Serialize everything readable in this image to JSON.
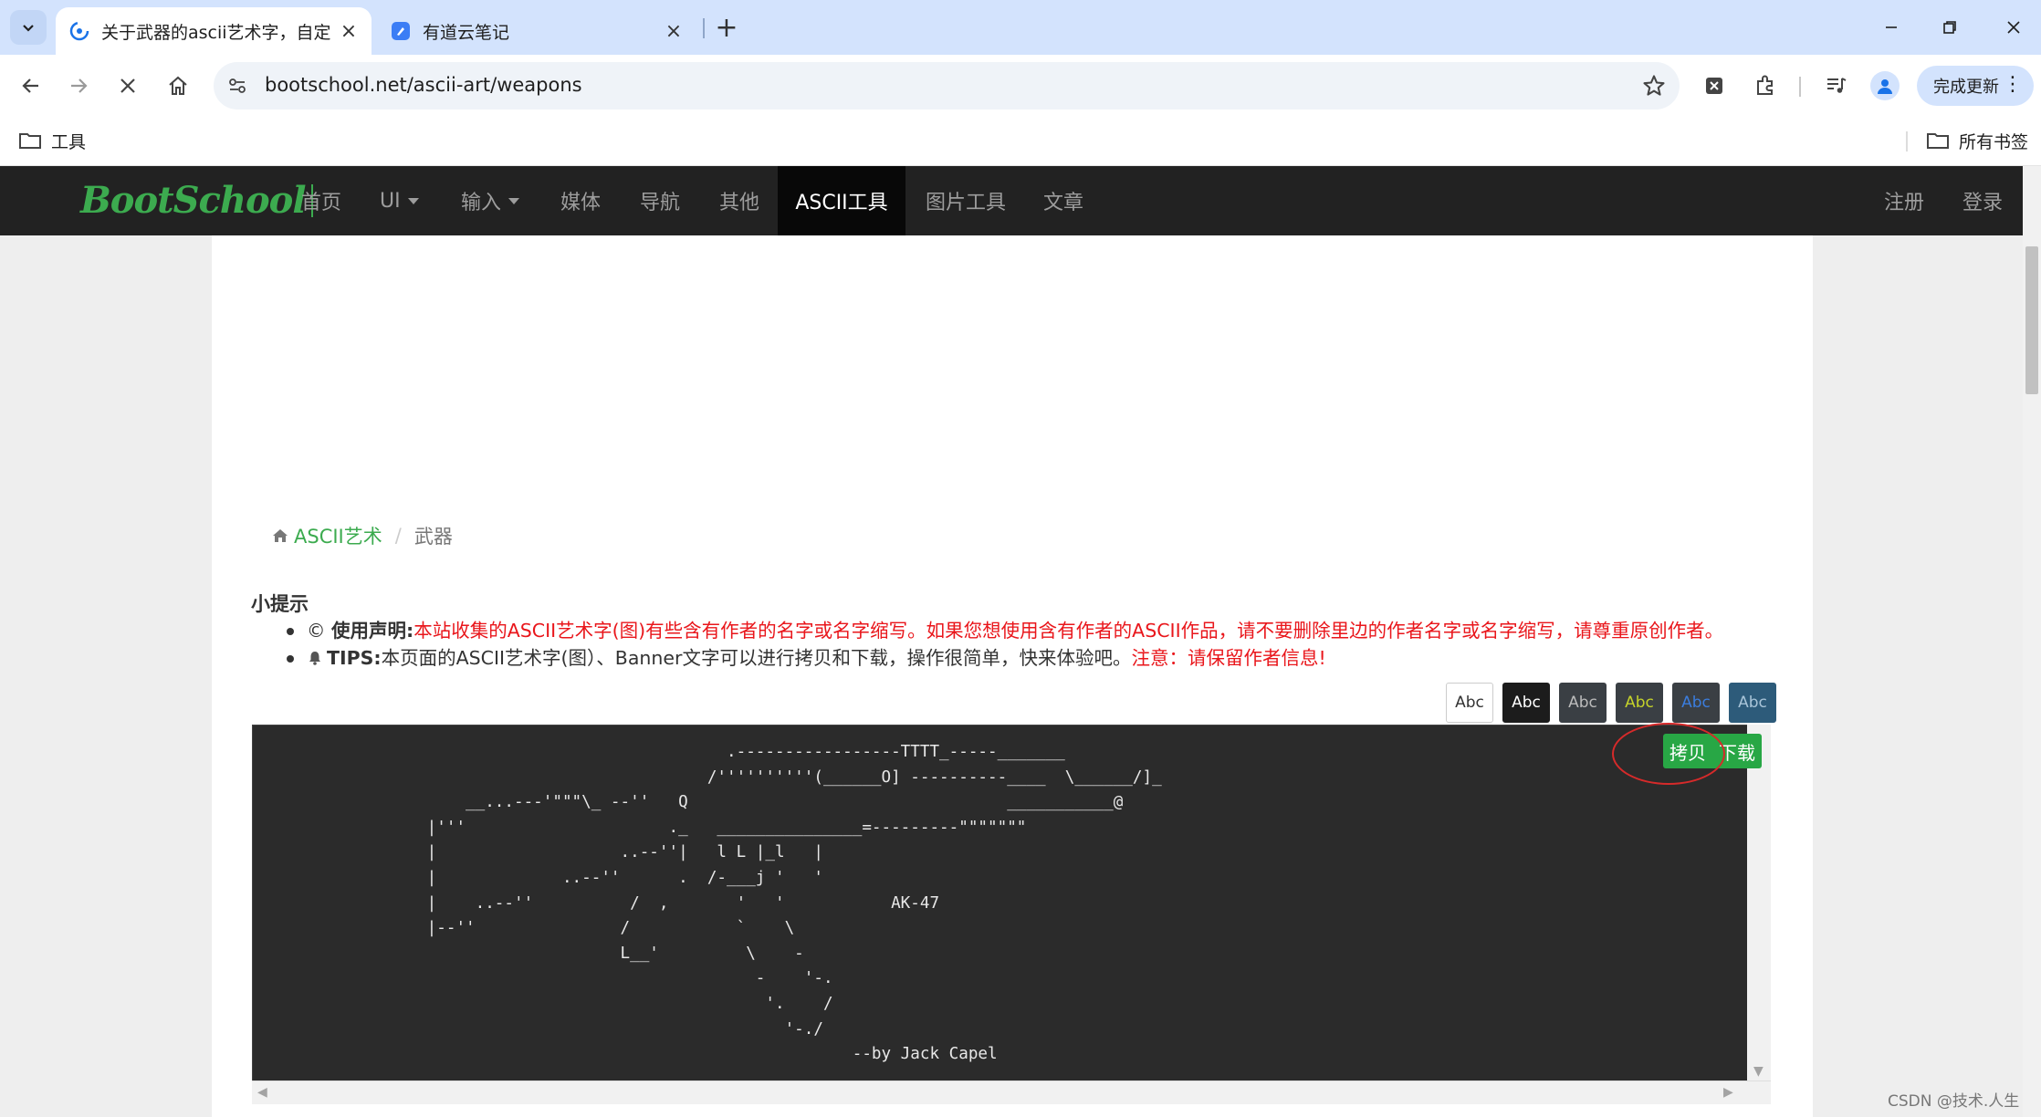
{
  "browser": {
    "tabs": [
      {
        "title": "关于武器的ascii艺术字，自定义",
        "active": true
      },
      {
        "title": "有道云笔记",
        "active": false
      }
    ],
    "url": "bootschool.net/ascii-art/weapons",
    "update_label": "完成更新",
    "bookmarks": {
      "tools": "工具",
      "all_bookmarks": "所有书签"
    }
  },
  "site": {
    "logo": "BootSchool",
    "nav": [
      {
        "label": "首页"
      },
      {
        "label": "UI",
        "dropdown": true
      },
      {
        "label": "输入",
        "dropdown": true
      },
      {
        "label": "媒体"
      },
      {
        "label": "导航"
      },
      {
        "label": "其他"
      },
      {
        "label": "ASCII工具",
        "active": true
      },
      {
        "label": "图片工具"
      },
      {
        "label": "文章"
      }
    ],
    "nav_right": {
      "register": "注册",
      "login": "登录"
    }
  },
  "breadcrumb": {
    "home": "ASCII艺术",
    "current": "武器"
  },
  "tips": {
    "title": "小提示",
    "item1_label": "使用声明:",
    "item1_text": "本站收集的ASCII艺术字(图)有些含有作者的名字或名字缩写。如果您想使用含有作者的ASCII作品，请不要删除里边的作者名字或名字缩写，请尊重原创作者。",
    "item2_label": "TIPS:",
    "item2_text": "本页面的ASCII艺术字(图）、Banner文字可以进行拷贝和下载，操作很简单，快来体验吧。",
    "item2_warn": "注意：请保留作者信息!"
  },
  "themes": [
    {
      "label": "Abc",
      "bg": "#ffffff",
      "fg": "#333333",
      "border": "#cccccc"
    },
    {
      "label": "Abc",
      "bg": "#1c1c1c",
      "fg": "#ffffff",
      "border": "#1c1c1c"
    },
    {
      "label": "Abc",
      "bg": "#3a3f44",
      "fg": "#bbbbbb",
      "border": "#3a3f44"
    },
    {
      "label": "Abc",
      "bg": "#3a3f44",
      "fg": "#c5d32a",
      "border": "#3a3f44"
    },
    {
      "label": "Abc",
      "bg": "#3a3f44",
      "fg": "#3b7ddd",
      "border": "#3a3f44"
    },
    {
      "label": "Abc",
      "bg": "#2d5b7a",
      "fg": "#a8c4d8",
      "border": "#2d5b7a"
    }
  ],
  "ascii_art": "                                                 .-----------------TTTT_-----_______\n                                               /''''''''''(______O] ----------____  \\______/]_\n                      __...---'\"\"\"\\_ --''   Q                                 ___________@\n                  |'''                     ._   _______________=---------\"\"\"\"\"\"\"\n                  |                   ..--''|   l L |_l   |\n                  |             ..--''      .  /-___j '   '\n                  |    ..--''          /  ,       '   '           AK-47\n                  |--''               /           `    \\\n                                      L__'         \\    -\n                                                    -    '-.\n                                                     '.    /\n                                                       '-./\n                                                              --by Jack Capel",
  "actions": {
    "copy": "拷贝",
    "download": "下载"
  },
  "watermark": "CSDN @技术.人生"
}
